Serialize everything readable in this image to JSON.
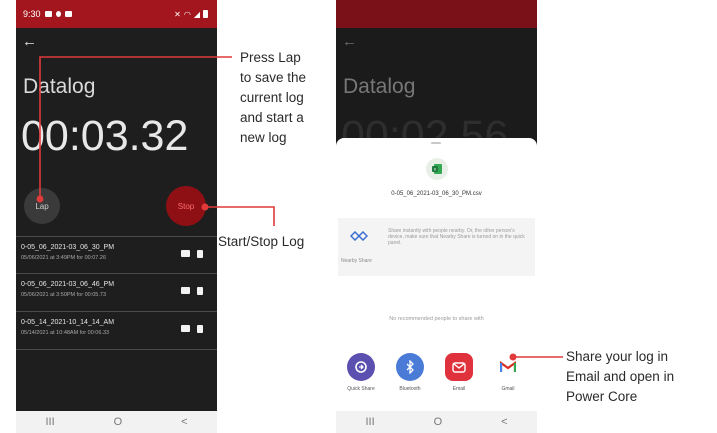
{
  "left_screen": {
    "status_time": "9:30",
    "title": "Datalog",
    "timer": "00:03.32",
    "lap_label": "Lap",
    "stop_label": "Stop",
    "logs": [
      {
        "name": "0-05_06_2021-03_06_30_PM",
        "meta": "05/06/2021 at 3:49PM for 00:07.26"
      },
      {
        "name": "0-05_06_2021-03_06_46_PM",
        "meta": "05/06/2021 at 3:50PM for 00:05.73"
      },
      {
        "name": "0-05_14_2021-10_14_14_AM",
        "meta": "05/14/2021 at 10:48AM for 00:06.33"
      }
    ]
  },
  "right_screen": {
    "title": "Datalog",
    "timer": "00:02.56",
    "file_name": "0-05_06_2021-03_06_30_PM.csv",
    "nearby_label": "Nearby Share",
    "nearby_desc": "Share instantly with people nearby. Or, the other person's device, make sure that Nearby Share is turned on in the quick panel.",
    "no_people": "No recommended people to share with",
    "apps": [
      {
        "label": "Quick Share",
        "color": "#5b4fb0"
      },
      {
        "label": "Bluetooth",
        "color": "#4a7bd6"
      },
      {
        "label": "Email",
        "color": "#e0323c"
      },
      {
        "label": "Gmail",
        "color": "#ffffff"
      }
    ]
  },
  "nav": {
    "recents": "III",
    "home": "O",
    "back": "<"
  },
  "annotations": {
    "lap_note": [
      "Press Lap",
      "to save the",
      "current log",
      "and start a",
      "new log"
    ],
    "stop_note": "Start/Stop Log",
    "share_note": [
      "Share your log in",
      "Email and open in",
      "Power Core"
    ]
  },
  "colors": {
    "accent": "#a3161d",
    "callout_line": "#e03a3a"
  }
}
